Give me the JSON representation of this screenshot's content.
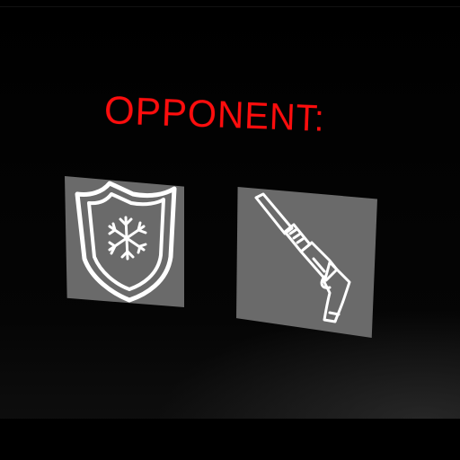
{
  "hud": {
    "heading": "OPPONENT:",
    "heading_color": "#ff0d0d"
  },
  "items": [
    {
      "icon": "shield-snowflake-icon"
    },
    {
      "icon": "shotgun-icon"
    }
  ],
  "colors": {
    "background": "#000000",
    "card": "#6a6a6a",
    "icon": "#ffffff"
  }
}
